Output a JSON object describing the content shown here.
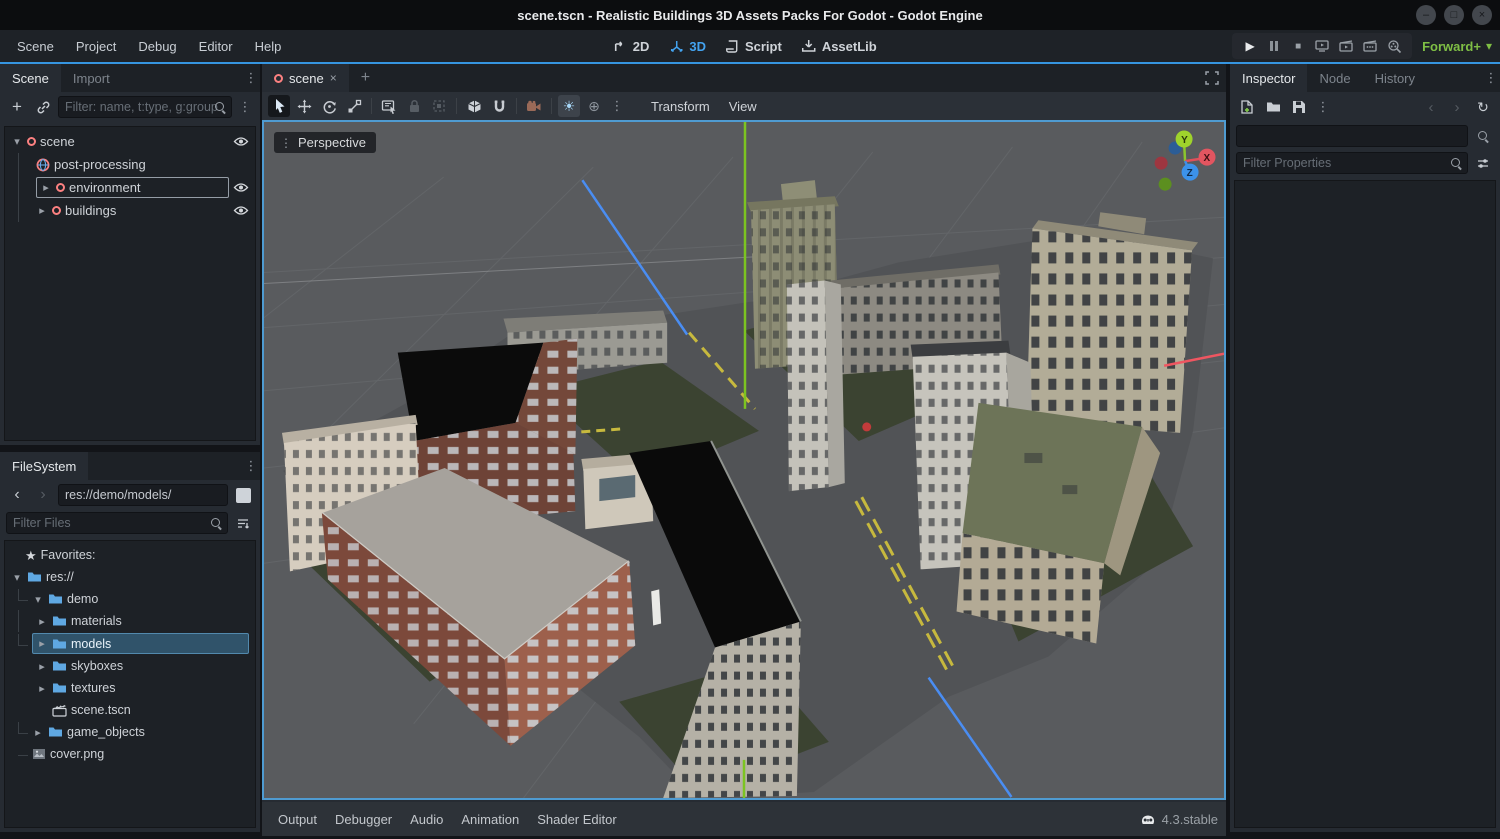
{
  "window": {
    "title": "scene.tscn - Realistic Buildings 3D Assets Packs For Godot - Godot Engine"
  },
  "menubar": {
    "items": [
      "Scene",
      "Project",
      "Debug",
      "Editor",
      "Help"
    ]
  },
  "context_switcher": {
    "items": [
      {
        "label": "2D"
      },
      {
        "label": "3D"
      },
      {
        "label": "Script"
      },
      {
        "label": "AssetLib"
      }
    ],
    "active": "3D"
  },
  "playback": {
    "icons": [
      "play",
      "pause",
      "stop",
      "play-remote-debug",
      "play-scene",
      "play-custom-scene",
      "movie-maker"
    ],
    "renderer": "Forward+"
  },
  "scene_dock": {
    "tabs": [
      "Scene",
      "Import"
    ],
    "active_tab": "Scene",
    "filter_placeholder": "Filter: name, t:type, g:group",
    "toolbar_icons": [
      "add-node",
      "instance-scene",
      "more"
    ],
    "tree": [
      {
        "label": "scene",
        "icon": "node3d-icon",
        "state": "expanded",
        "eye": true
      },
      {
        "label": "post-processing",
        "icon": "world-environment-icon",
        "state": "leaf",
        "eye": false
      },
      {
        "label": "environment",
        "icon": "node3d-icon",
        "state": "collapsed",
        "eye": true,
        "focused": true
      },
      {
        "label": "buildings",
        "icon": "node3d-icon",
        "state": "collapsed",
        "eye": true
      }
    ]
  },
  "filesystem_dock": {
    "tab": "FileSystem",
    "path": "res://demo/models/",
    "filter_placeholder": "Filter Files",
    "tree": [
      {
        "label": "Favorites:",
        "icon": "star-icon",
        "indent": 0
      },
      {
        "label": "res://",
        "icon": "folder-icon",
        "indent": 0,
        "state": "expanded"
      },
      {
        "label": "demo",
        "icon": "folder-icon",
        "indent": 1,
        "state": "expanded"
      },
      {
        "label": "materials",
        "icon": "folder-icon",
        "indent": 2,
        "state": "collapsed"
      },
      {
        "label": "models",
        "icon": "folder-icon",
        "indent": 2,
        "state": "collapsed",
        "selected": true
      },
      {
        "label": "skyboxes",
        "icon": "folder-icon",
        "indent": 2,
        "state": "collapsed"
      },
      {
        "label": "textures",
        "icon": "folder-icon",
        "indent": 2,
        "state": "collapsed"
      },
      {
        "label": "scene.tscn",
        "icon": "packed-scene-icon",
        "indent": 2
      },
      {
        "label": "game_objects",
        "icon": "folder-icon",
        "indent": 1,
        "state": "collapsed"
      },
      {
        "label": "cover.png",
        "icon": "image-icon",
        "indent": 1
      }
    ]
  },
  "viewport": {
    "tab_label": "scene",
    "projection_label": "Perspective",
    "menus": [
      "Transform",
      "View"
    ],
    "toolbar_icons": [
      "select-tool",
      "move-tool",
      "rotate-tool",
      "scale-tool",
      "list-select-tool",
      "lock-selected",
      "group-selected",
      "local-space-toggle",
      "snap-toggle",
      "camera-override",
      "preview-sun",
      "preview-environment",
      "more"
    ],
    "active_tool": "select-tool",
    "toggled": [
      "preview-sun"
    ],
    "gizmo": {
      "x": "X",
      "y": "Y",
      "z": "Z"
    }
  },
  "inspector_dock": {
    "tabs": [
      "Inspector",
      "Node",
      "History"
    ],
    "active_tab": "Inspector",
    "filter_placeholder": "Filter Properties",
    "toolbar_icons": [
      "new-resource",
      "load-resource",
      "save-resource",
      "more",
      "history-back",
      "history-forward",
      "object-history",
      "open-docs",
      "extra-filters"
    ]
  },
  "bottom_bar": {
    "items": [
      "Output",
      "Debugger",
      "Audio",
      "Animation",
      "Shader Editor"
    ],
    "version": "4.3.stable"
  },
  "icons": {
    "chevron_down": "▾",
    "chevron_right": "▸",
    "nav_back": "‹",
    "nav_fwd": "›",
    "more_vertical": "⋮",
    "star": "★",
    "add": "+",
    "close_tab": "×",
    "sun": "☀",
    "globe": "⊕",
    "play": "▶",
    "stop": "■",
    "history": "↻",
    "minimize": "–",
    "maximize": "□",
    "close": "×",
    "renderer_caret": "▾"
  },
  "colors": {
    "accent_blue": "#3695e0",
    "active_3d_blue": "#43a3f0",
    "renderer_green": "#7fbf45",
    "node_red": "#fc8181",
    "folder_blue": "#5fa8e2",
    "viewport_bg": "#595b5e",
    "axis_x": "#ef5661",
    "axis_y": "#7cc421",
    "axis_z": "#4a8df2",
    "selected_row": "#30536a",
    "viewport_focus_border": "#4f9bd1"
  }
}
